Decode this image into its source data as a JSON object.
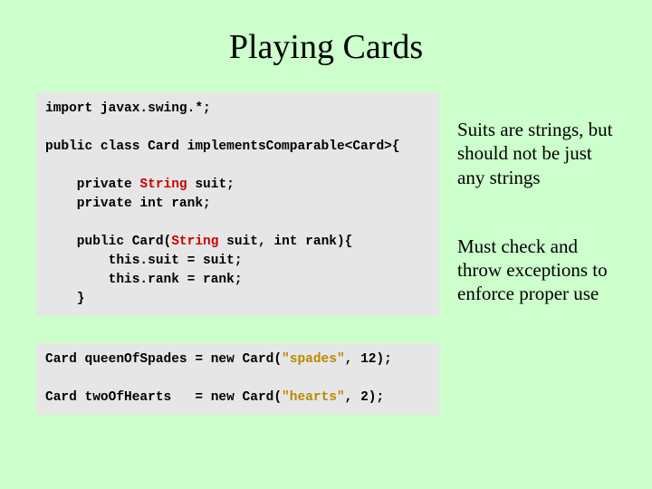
{
  "title": "Playing Cards",
  "code1": {
    "l1": "import javax.swing.*;",
    "l2": "public class Card implementsComparable<Card>{",
    "l3a": "    private ",
    "l3type": "String",
    "l3b": " suit;",
    "l4": "    private int rank;",
    "l5a": "    public Card(",
    "l5type": "String",
    "l5b": " suit, int rank){",
    "l6": "        this.suit = suit;",
    "l7": "        this.rank = rank;",
    "l8": "    }"
  },
  "code2": {
    "l1a": "Card queenOfSpades = new Card(",
    "l1str": "\"spades\"",
    "l1b": ", 12);",
    "l2a": "Card twoOfHearts   = new Card(",
    "l2str": "\"hearts\"",
    "l2b": ", 2);"
  },
  "annotation1": "Suits are strings, but should not be just any strings",
  "annotation2": "Must check and throw exceptions to enforce proper use"
}
